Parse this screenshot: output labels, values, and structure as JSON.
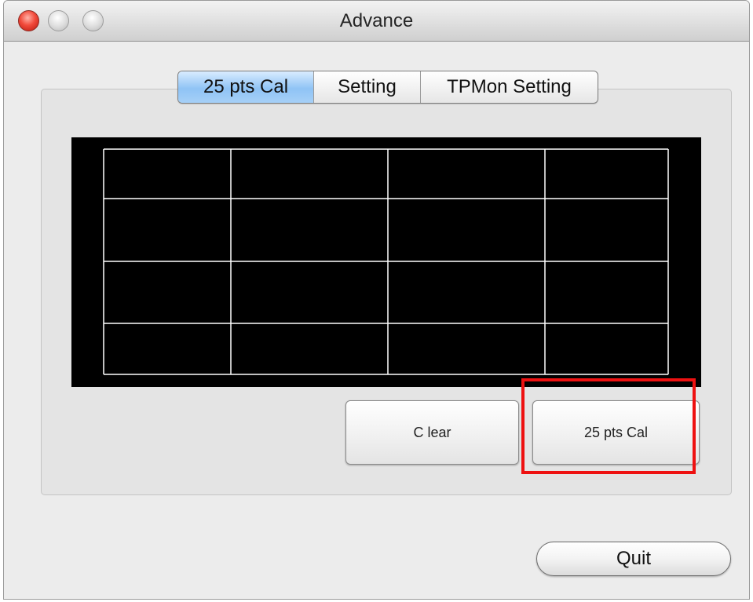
{
  "window": {
    "title": "Advance"
  },
  "tabs": [
    {
      "label": "25 pts Cal",
      "selected": true
    },
    {
      "label": "Setting",
      "selected": false
    },
    {
      "label": "TPMon Setting",
      "selected": false
    }
  ],
  "calibration_panel": {
    "columns": 4,
    "rows": 4,
    "background": "#000000",
    "line_color": "#ffffff"
  },
  "buttons": {
    "clear_label": "C lear",
    "cal_label": "25 pts Cal",
    "quit_label": "Quit"
  },
  "colors": {
    "highlight": "#ee1111",
    "active_tab": "#8fc3f5"
  }
}
